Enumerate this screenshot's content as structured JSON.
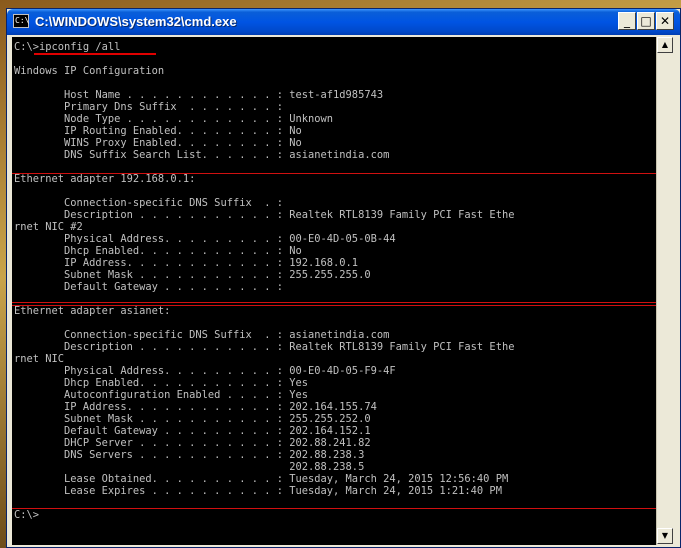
{
  "window": {
    "title": "C:\\WINDOWS\\system32\\cmd.exe",
    "icon_label": "C:\\",
    "minimize_glyph": "_",
    "maximize_glyph": "□",
    "close_glyph": "✕"
  },
  "console": {
    "lines": [
      "C:\\>ipconfig /all",
      "",
      "Windows IP Configuration",
      "",
      "        Host Name . . . . . . . . . . . . : test-af1d985743",
      "        Primary Dns Suffix  . . . . . . . :",
      "        Node Type . . . . . . . . . . . . : Unknown",
      "        IP Routing Enabled. . . . . . . . : No",
      "        WINS Proxy Enabled. . . . . . . . : No",
      "        DNS Suffix Search List. . . . . . : asianetindia.com",
      "",
      "Ethernet adapter 192.168.0.1:",
      "",
      "        Connection-specific DNS Suffix  . :",
      "        Description . . . . . . . . . . . : Realtek RTL8139 Family PCI Fast Ethe",
      "rnet NIC #2",
      "        Physical Address. . . . . . . . . : 00-E0-4D-05-0B-44",
      "        Dhcp Enabled. . . . . . . . . . . : No",
      "        IP Address. . . . . . . . . . . . : 192.168.0.1",
      "        Subnet Mask . . . . . . . . . . . : 255.255.255.0",
      "        Default Gateway . . . . . . . . . :",
      "",
      "Ethernet adapter asianet:",
      "",
      "        Connection-specific DNS Suffix  . : asianetindia.com",
      "        Description . . . . . . . . . . . : Realtek RTL8139 Family PCI Fast Ethe",
      "rnet NIC",
      "        Physical Address. . . . . . . . . : 00-E0-4D-05-F9-4F",
      "        Dhcp Enabled. . . . . . . . . . . : Yes",
      "        Autoconfiguration Enabled . . . . : Yes",
      "        IP Address. . . . . . . . . . . . : 202.164.155.74",
      "        Subnet Mask . . . . . . . . . . . : 255.255.252.0",
      "        Default Gateway . . . . . . . . . : 202.164.152.1",
      "        DHCP Server . . . . . . . . . . . : 202.88.241.82",
      "        DNS Servers . . . . . . . . . . . : 202.88.238.3",
      "                                            202.88.238.5",
      "        Lease Obtained. . . . . . . . . . : Tuesday, March 24, 2015 12:56:40 PM",
      "        Lease Expires . . . . . . . . . . : Tuesday, March 24, 2015 1:21:40 PM",
      "",
      "C:\\>"
    ]
  },
  "scrollbar": {
    "up_glyph": "▲",
    "down_glyph": "▼"
  },
  "colors": {
    "console_background": "#000000",
    "console_text": "#c0c0c0",
    "titlebar": "#0054e3",
    "annotation": "#d01010"
  }
}
